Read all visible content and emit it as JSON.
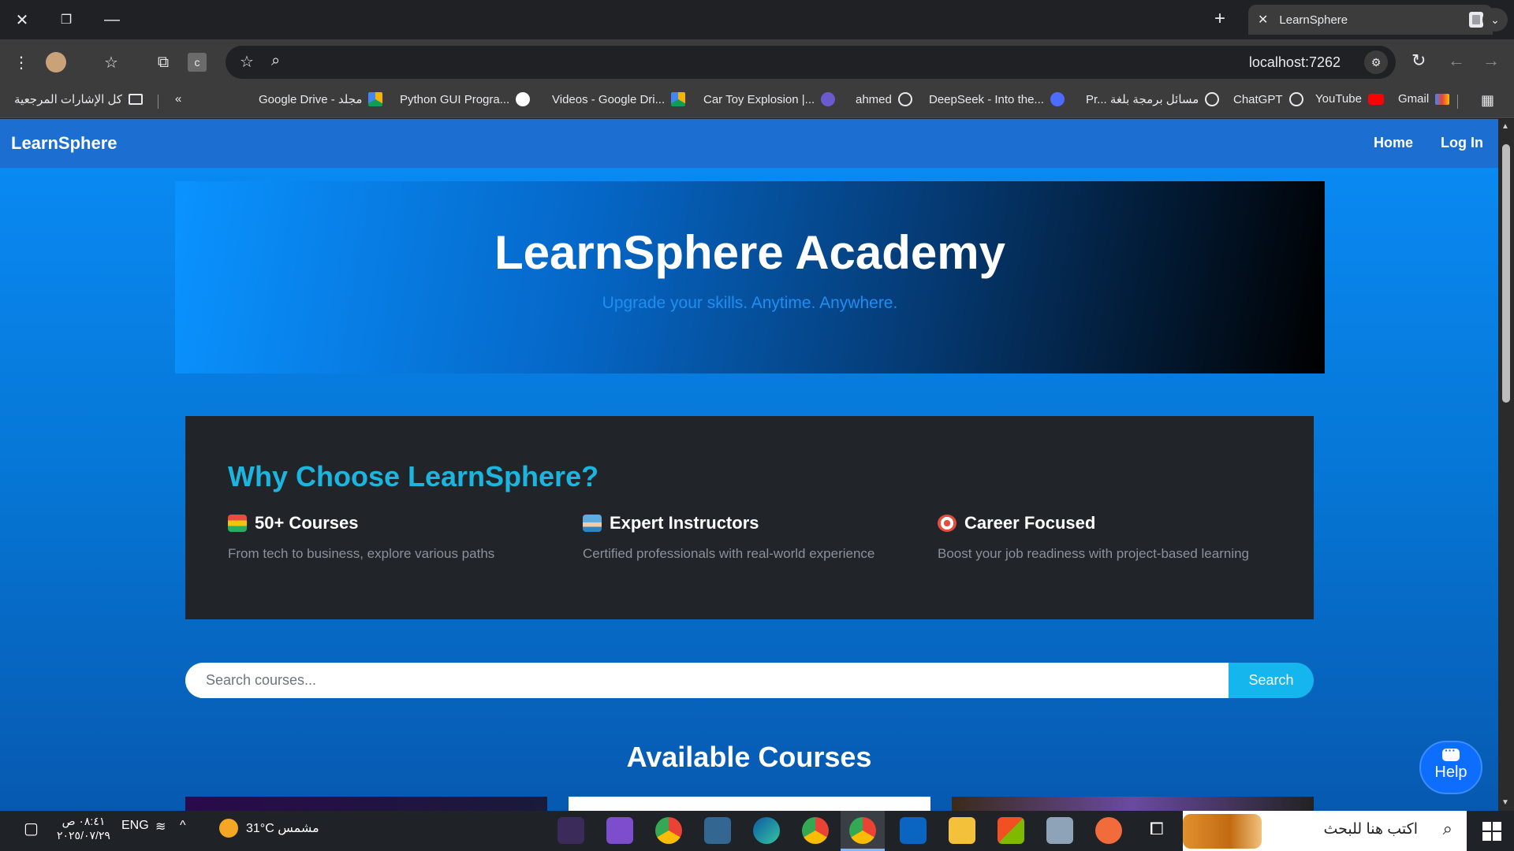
{
  "browser": {
    "tab": {
      "title": "LearnSphere",
      "close": "✕",
      "new_tab": "+",
      "menu": "⌄"
    },
    "window": {
      "close": "✕",
      "restore": "❐",
      "minimize": "—"
    },
    "toolbar": {
      "url": "localhost:7262",
      "site_settings": "⚙",
      "menu": "⋮",
      "favorites": "☆",
      "extensions": "⧉",
      "reload": "↻",
      "back": "←",
      "forward": "→"
    },
    "bookmarks": {
      "all_bookmarks": "كل الإشارات المرجعية",
      "overflow": "«",
      "items": [
        {
          "label": "Google Drive - مجلد",
          "icon": "google-drive-icon",
          "color": "#f4b400"
        },
        {
          "label": "Python GUI Progra...",
          "icon": "python-icon",
          "color": "#ffffff"
        },
        {
          "label": "Videos - Google Dri...",
          "icon": "google-drive-icon",
          "color": "#0f9d58"
        },
        {
          "label": "Car Toy Explosion |...",
          "icon": "star-badge-icon",
          "color": "#6a5acd"
        },
        {
          "label": "ahmed",
          "icon": "globe-icon",
          "color": "#e8eaed"
        },
        {
          "label": "DeepSeek - Into the...",
          "icon": "deepseek-icon",
          "color": "#4d6bfe"
        },
        {
          "label": "Pr... مسائل برمجة بلغة",
          "icon": "logo-icon",
          "color": "#e8eaed"
        },
        {
          "label": "ChatGPT",
          "icon": "chatgpt-icon",
          "color": "#e8eaed"
        },
        {
          "label": "YouTube",
          "icon": "youtube-icon",
          "color": "#ff0000"
        },
        {
          "label": "Gmail",
          "icon": "gmail-icon",
          "color": "#ea4335"
        }
      ]
    }
  },
  "page": {
    "brand": "LearnSphere",
    "nav": {
      "home": "Home",
      "login": "Log In"
    },
    "hero": {
      "title": "LearnSphere Academy",
      "subtitle": "Upgrade your skills. Anytime. Anywhere."
    },
    "why": {
      "heading": "Why Choose LearnSphere?",
      "features": [
        {
          "title": "50+ Courses",
          "desc": "From tech to business, explore various paths",
          "icon": "books-icon"
        },
        {
          "title": "Expert Instructors",
          "desc": "Certified professionals with real-world experience",
          "icon": "teacher-icon"
        },
        {
          "title": "Career Focused",
          "desc": "Boost your job readiness with project-based learning",
          "icon": "target-icon"
        }
      ]
    },
    "search": {
      "placeholder": "Search courses...",
      "button": "Search"
    },
    "courses_heading": "Available Courses",
    "help": "Help"
  },
  "taskbar": {
    "time": "٠٨:٤١ ص",
    "date": "٢٠٢٥/٠٧/٢٩",
    "lang": "ENG",
    "weather": "31°C مشمس",
    "search_placeholder": "اكتب هنا للبحث"
  },
  "colors": {
    "accent": "#1bb5e0",
    "navbar": "#1c6fd1",
    "search_button": "#15b6ee",
    "card_bg": "#212529"
  }
}
